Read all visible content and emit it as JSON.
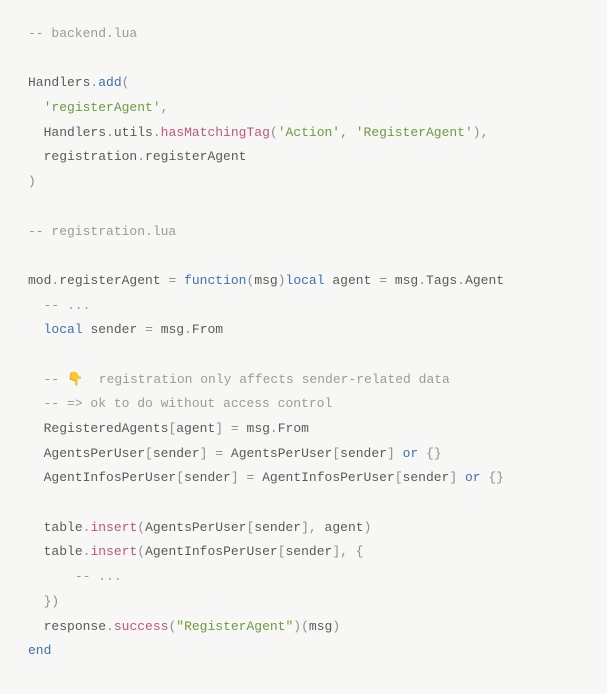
{
  "code": {
    "comment_backend": "-- backend.lua",
    "handlers": "Handlers",
    "dot": ".",
    "add": "add",
    "lparen": "(",
    "rparen": ")",
    "comma": ",",
    "lbrace": "{",
    "rbrace": "}",
    "lbracket": "[",
    "rbracket": "]",
    "eq": "=",
    "str_registerAgent": "'registerAgent'",
    "utils": "utils",
    "hasMatchingTag": "hasMatchingTag",
    "str_Action": "'Action'",
    "str_RegisterAgent": "'RegisterAgent'",
    "registration": "registration",
    "registerAgent": "registerAgent",
    "comment_registration": "-- registration.lua",
    "mod": "mod",
    "kw_function": "function",
    "msg": "msg",
    "kw_local": "local",
    "agent": "agent",
    "Tags": "Tags",
    "Agent": "Agent",
    "comment_ellipsis": "-- ...",
    "sender": "sender",
    "From": "From",
    "comment_point": "-- 👇  registration only affects sender-related data",
    "comment_ok": "-- => ok to do without access control",
    "RegisteredAgents": "RegisteredAgents",
    "AgentsPerUser": "AgentsPerUser",
    "AgentInfosPerUser": "AgentInfosPerUser",
    "kw_or": "or",
    "table": "table",
    "insert": "insert",
    "response": "response",
    "success": "success",
    "str_RegisterAgent_dq": "\"RegisterAgent\"",
    "kw_end": "end"
  }
}
